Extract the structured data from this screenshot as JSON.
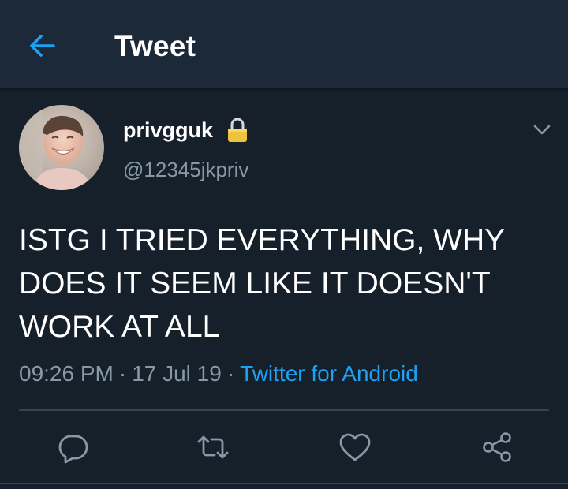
{
  "colors": {
    "background": "#15202b",
    "header_background": "#1c2938",
    "accent": "#1da1f2",
    "secondary_text": "#8899a6",
    "divider": "#38444d"
  },
  "header": {
    "back_icon": "arrow-left-icon",
    "title": "Tweet"
  },
  "tweet": {
    "author": {
      "display_name": "privgguk",
      "protected_icon": "lock-icon",
      "handle": "@12345jkpriv"
    },
    "menu_icon": "chevron-down-icon",
    "text": "ISTG I TRIED EVERYTHING, WHY DOES IT SEEM LIKE IT DOESN'T WORK AT ALL",
    "time": "09:26 PM",
    "date": "17 Jul 19",
    "separator": "·",
    "source": "Twitter for Android"
  },
  "actions": [
    {
      "name": "reply",
      "icon": "reply-icon"
    },
    {
      "name": "retweet",
      "icon": "retweet-icon"
    },
    {
      "name": "like",
      "icon": "heart-icon"
    },
    {
      "name": "share",
      "icon": "share-icon"
    }
  ]
}
